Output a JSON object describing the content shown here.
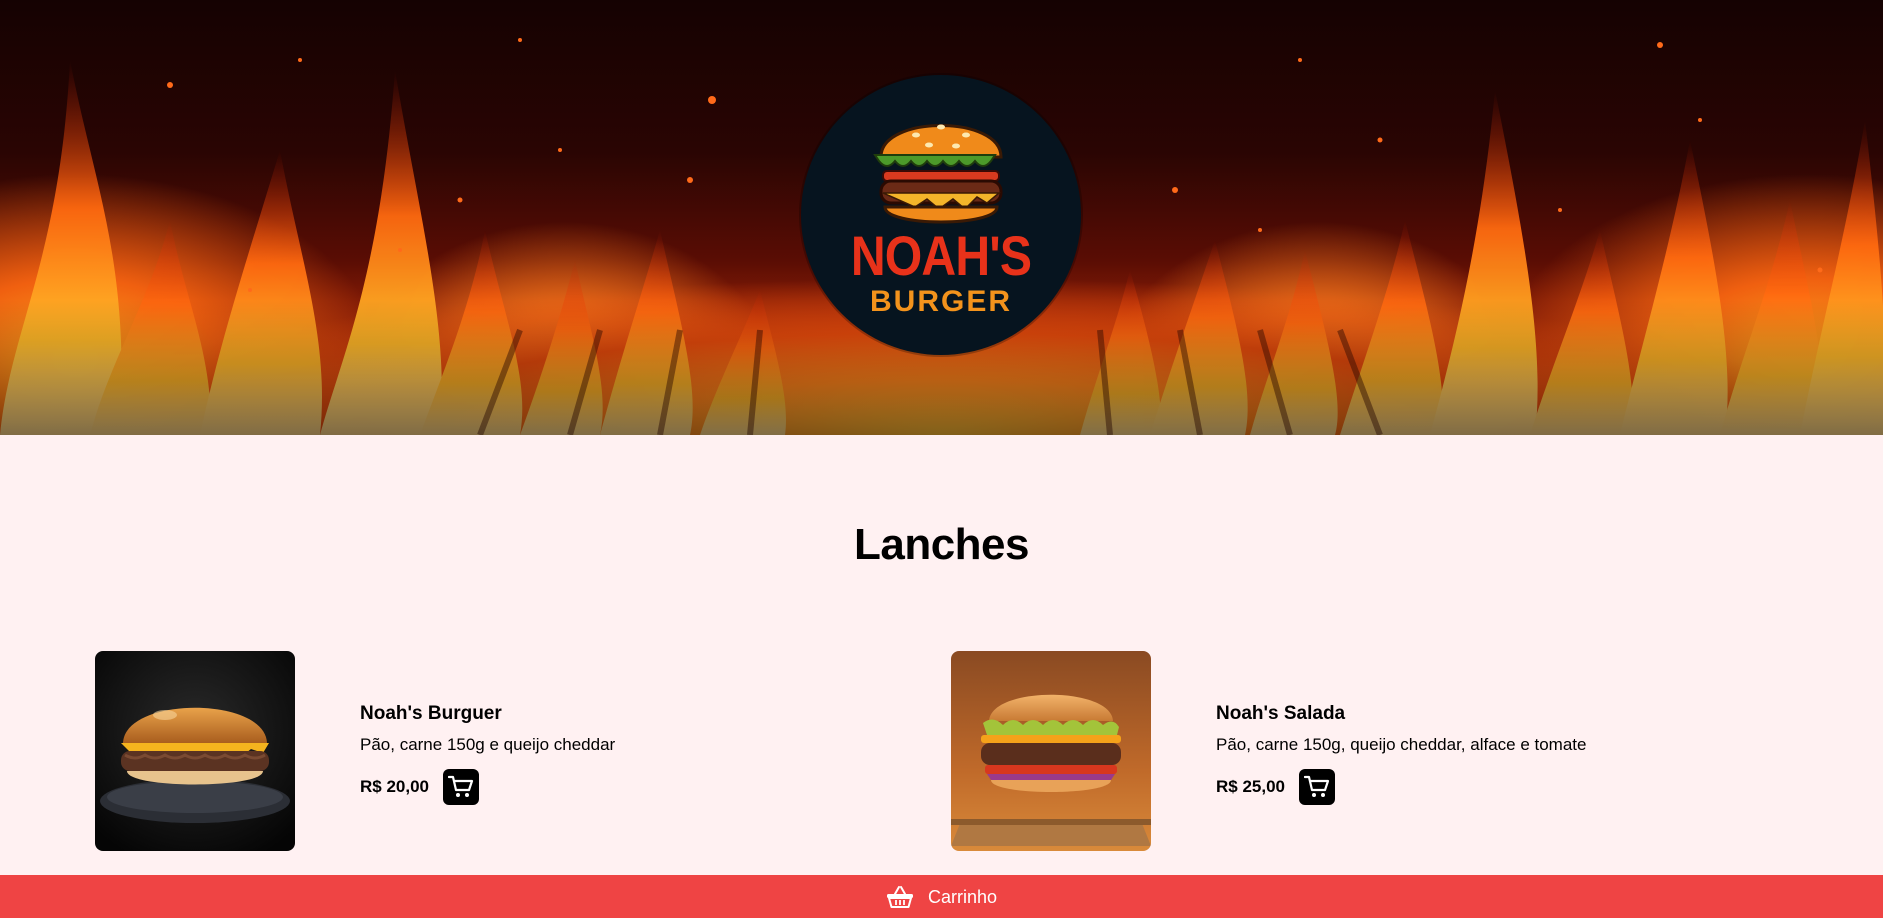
{
  "brand": {
    "name_line1": "NOAH'S",
    "name_line2": "BURGER",
    "colors": {
      "logo_bg": "#06141f",
      "name_red": "#e8321a",
      "name_orange": "#f3931c"
    }
  },
  "menu": {
    "title": "Lanches",
    "items": [
      {
        "name": "Noah's Burguer",
        "description": "Pão, carne 150g e queijo cheddar",
        "price": "R$ 20,00",
        "image": "burger-photo",
        "cart_icon": "cart-icon"
      },
      {
        "name": "Noah's Salada",
        "description": "Pão, carne 150g, queijo cheddar, alface e tomate",
        "price": "R$ 25,00",
        "image": "salad-burger-photo",
        "cart_icon": "cart-icon"
      }
    ]
  },
  "cart_bar": {
    "label": "Carrinho",
    "icon": "basket-icon",
    "color": "#ef4444"
  },
  "colors": {
    "page_bg": "#fff1f2",
    "button_bg": "#000000"
  }
}
